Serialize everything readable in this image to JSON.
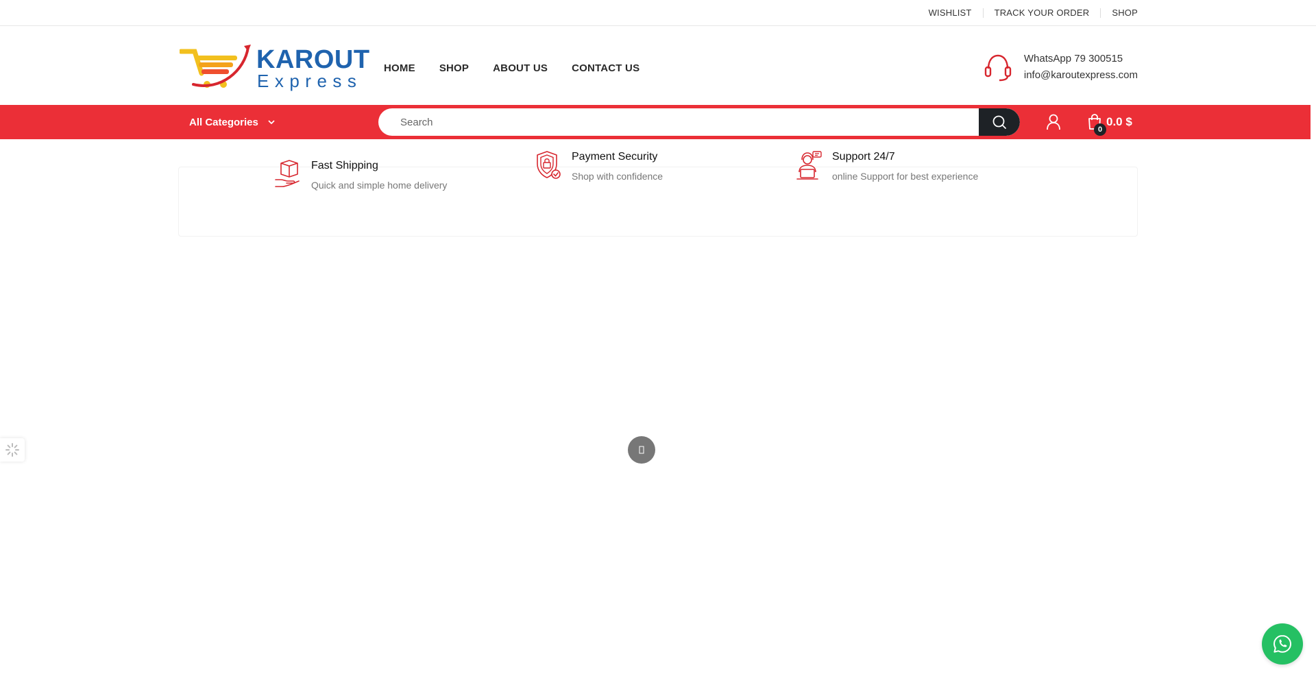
{
  "topbar": {
    "links": [
      "WISHLIST",
      "TRACK YOUR ORDER",
      "SHOP"
    ]
  },
  "header": {
    "logo_word": "KAROUT",
    "logo_sub": "Express",
    "nav": [
      "HOME",
      "SHOP",
      "ABOUT US",
      "CONTACT US"
    ],
    "contact_whatsapp": "WhatsApp 79 300515",
    "contact_email": "info@karoutexpress.com",
    "contact_icon": "headset-icon"
  },
  "searchbar": {
    "category_label": "All Categories",
    "placeholder": "Search",
    "cart_count": "0",
    "cart_total": "0.0 $"
  },
  "features": [
    {
      "icon": "shipping-box-icon",
      "title": "Fast Shipping",
      "desc": "Quick and simple home delivery"
    },
    {
      "icon": "security-shield-icon",
      "title": "Payment Security",
      "desc": "Shop with confidence"
    },
    {
      "icon": "support-agent-icon",
      "title": "Support 24/7",
      "desc": "online Support for best experience"
    }
  ],
  "colors": {
    "brand_red": "#eb2f37",
    "brand_blue": "#1f63ae",
    "dark": "#1e2226",
    "whatsapp_green": "#25c063"
  }
}
